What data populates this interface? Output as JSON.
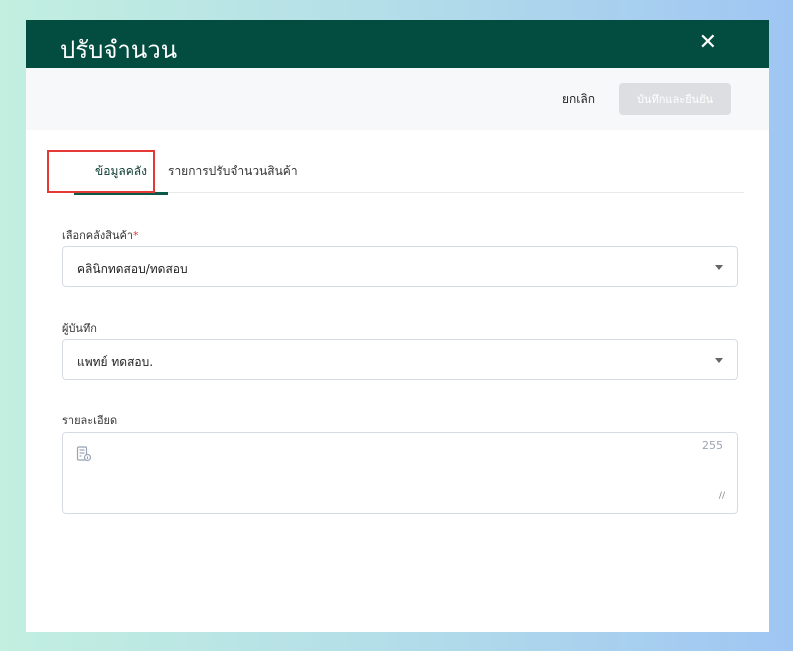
{
  "modal": {
    "title": "ปรับจำนวน",
    "close_icon": "close-icon"
  },
  "toolbar": {
    "cancel_label": "ยกเลิก",
    "confirm_label": "บันทึกและยืนยัน"
  },
  "tabs": [
    {
      "label": "ข้อมูลคลัง",
      "active": true
    },
    {
      "label": "รายการปรับจำนวนสินค้า",
      "active": false
    }
  ],
  "form": {
    "warehouse": {
      "label": "เลือกคลังสินค้า",
      "required_mark": "*",
      "value": "คลินิกทดสอบ/ทดสอบ"
    },
    "recorder": {
      "label": "ผู้บันทึก",
      "value": "แพทย์ ทดสอบ."
    },
    "details": {
      "label": "รายละเอียด",
      "value": "",
      "max_length": "255"
    }
  },
  "colors": {
    "header": "#034d40",
    "highlight": "#e53935"
  }
}
